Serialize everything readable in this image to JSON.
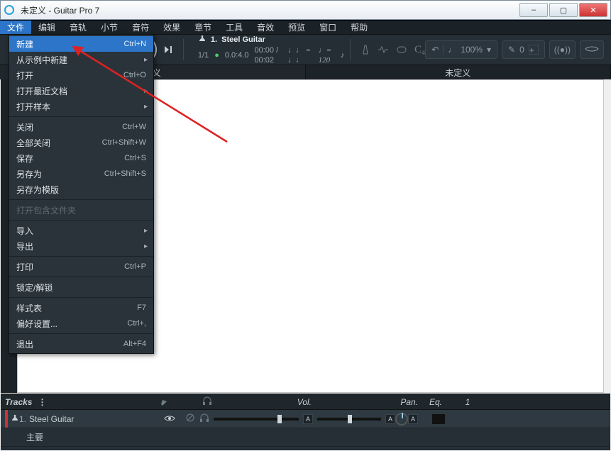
{
  "window": {
    "title": "未定义 - Guitar Pro 7",
    "app_icon": "guitar-pro-icon",
    "min": "–",
    "max": "▢",
    "close": "✕"
  },
  "menus": [
    "文件",
    "编辑",
    "音轨",
    "小节",
    "音符",
    "效果",
    "章节",
    "工具",
    "音效",
    "预览",
    "窗口",
    "帮助"
  ],
  "open_menu_index": 0,
  "file_menu": [
    {
      "label": "新建",
      "shortcut": "Ctrl+N",
      "hl": true
    },
    {
      "label": "从示例中新建",
      "sub": true
    },
    {
      "label": "打开",
      "shortcut": "Ctrl+O"
    },
    {
      "label": "打开最近文档",
      "sub": true
    },
    {
      "label": "打开样本",
      "sub": true
    },
    {
      "sep": true
    },
    {
      "label": "关闭",
      "shortcut": "Ctrl+W"
    },
    {
      "label": "全部关闭",
      "shortcut": "Ctrl+Shift+W"
    },
    {
      "label": "保存",
      "shortcut": "Ctrl+S"
    },
    {
      "label": "另存为",
      "shortcut": "Ctrl+Shift+S"
    },
    {
      "label": "另存为模版"
    },
    {
      "sep": true
    },
    {
      "label": "打开包含文件夹",
      "disabled": true
    },
    {
      "sep": true
    },
    {
      "label": "导入",
      "sub": true
    },
    {
      "label": "导出",
      "sub": true
    },
    {
      "sep": true
    },
    {
      "label": "打印",
      "shortcut": "Ctrl+P"
    },
    {
      "sep": true
    },
    {
      "label": "锁定/解锁"
    },
    {
      "sep": true
    },
    {
      "label": "样式表",
      "shortcut": "F7"
    },
    {
      "label": "偏好设置...",
      "shortcut": "Ctrl+,"
    },
    {
      "sep": true
    },
    {
      "label": "退出",
      "shortcut": "Alt+F4"
    }
  ],
  "transport": {
    "track_no": "1.",
    "track_name": "Steel Guitar",
    "bar": "1/1",
    "rec": "●",
    "time": "0.0:4.0",
    "timepos": "00:00 / 00:02",
    "sig": "♩♩ = ♩♩",
    "tempo": "♩= 120",
    "tempo_unit": "♪"
  },
  "right_tools": {
    "zoom": "100%",
    "pen": "0"
  },
  "tabs": [
    "定义",
    "未定义"
  ],
  "active_tab": 1,
  "tracks_header": {
    "label": "Tracks",
    "vol": "Vol.",
    "pan": "Pan.",
    "eq": "Eq.",
    "ch": "1"
  },
  "track_row": {
    "index": "1.",
    "name": "Steel Guitar",
    "second": "主要"
  }
}
